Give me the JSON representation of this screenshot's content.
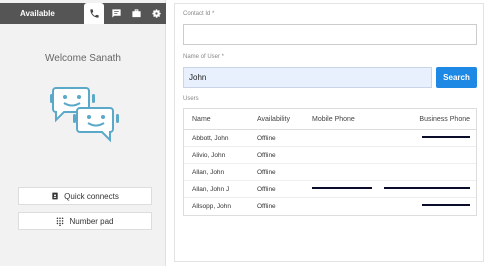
{
  "left_panel": {
    "status_label": "Available",
    "welcome_text": "Welcome Sanath",
    "quick_connects_label": "Quick connects",
    "number_pad_label": "Number pad"
  },
  "form": {
    "contact_id_label": "Contact Id *",
    "contact_id_value": "",
    "name_of_user_label": "Name of User *",
    "name_of_user_value": "John",
    "search_label": "Search"
  },
  "users": {
    "label": "Users",
    "columns": [
      "Name",
      "Availability",
      "Mobile Phone",
      "Business Phone"
    ],
    "rows": [
      {
        "name": "Abbott, John",
        "availability": "Offline"
      },
      {
        "name": "Alivio, John",
        "availability": "Offline"
      },
      {
        "name": "Allan, John",
        "availability": "Offline"
      },
      {
        "name": "Allan, John J",
        "availability": "Offline"
      },
      {
        "name": "Allsopp, John",
        "availability": "Offline"
      }
    ]
  },
  "colors": {
    "accent": "#1e88e5",
    "topbar": "#555555",
    "bot_blue": "#5aa9c8"
  }
}
